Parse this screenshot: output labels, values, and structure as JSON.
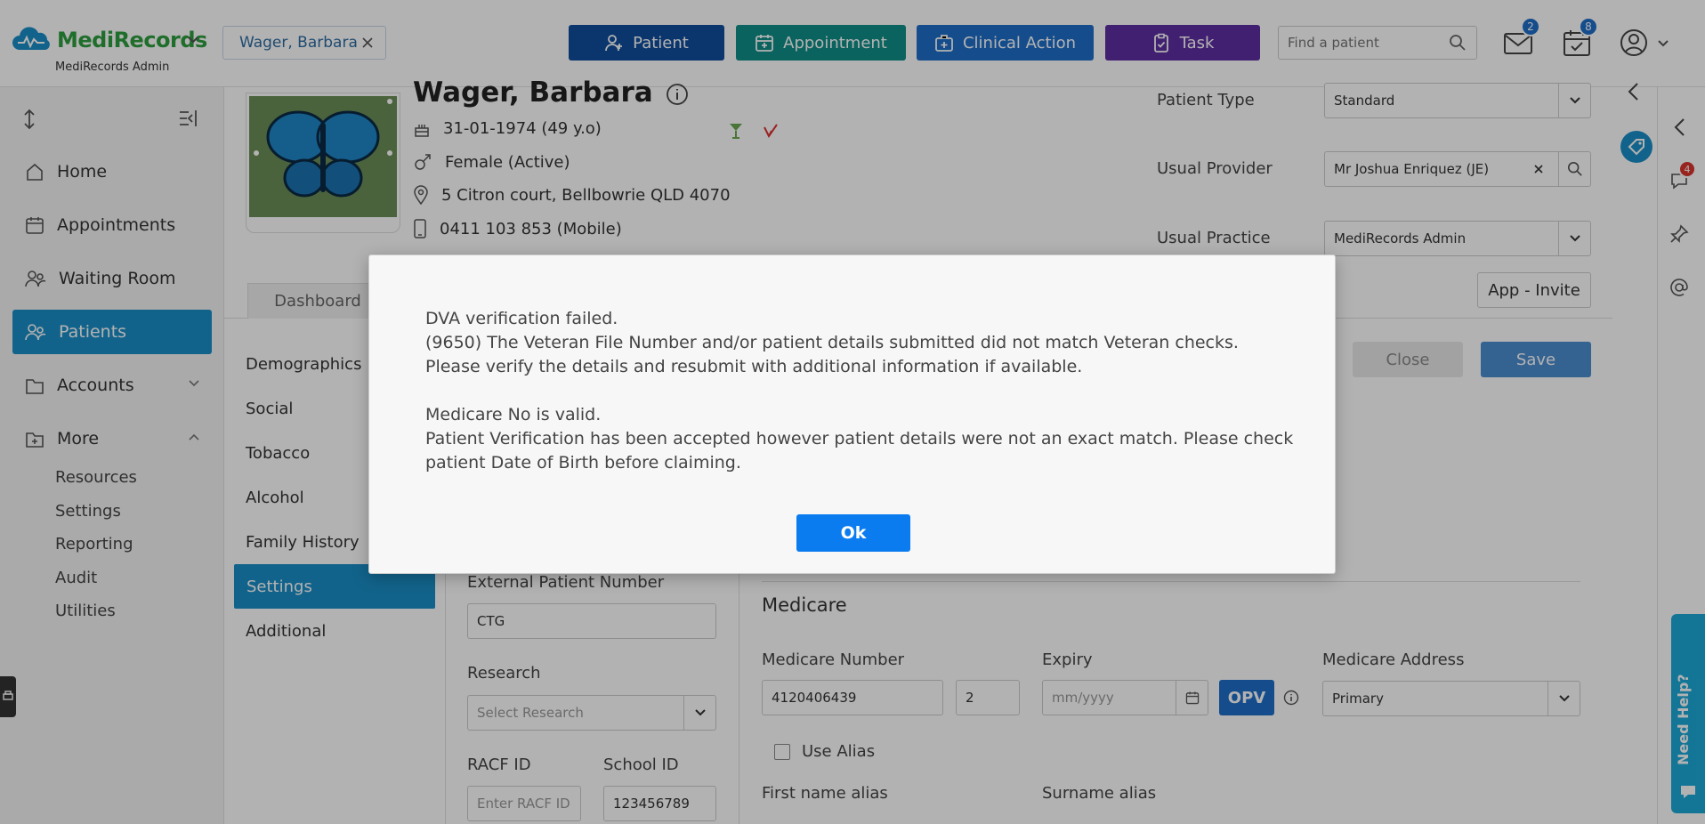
{
  "header": {
    "brand": "MediRecords",
    "brand_sub": "MediRecords Admin",
    "patient_tab": "Wager, Barbara",
    "buttons": {
      "patient": "Patient",
      "appointment": "Appointment",
      "clinical": "Clinical Action",
      "task": "Task"
    },
    "search_placeholder": "Find a patient",
    "mail_count": "2",
    "calendar_count": "8"
  },
  "colors": {
    "patient": "#0f4c9c",
    "appointment": "#0f8f87",
    "clinical": "#1f6fc9",
    "task": "#5f2ea3",
    "accent": "#1b8ec7"
  },
  "sidebar": {
    "items": [
      {
        "label": "Home",
        "icon": "home-icon"
      },
      {
        "label": "Appointments",
        "icon": "calendar-icon"
      },
      {
        "label": "Waiting Room",
        "icon": "people-icon"
      },
      {
        "label": "Patients",
        "icon": "patients-icon"
      },
      {
        "label": "Accounts",
        "icon": "folder-icon"
      },
      {
        "label": "More",
        "icon": "folder-plus-icon"
      }
    ],
    "more_items": [
      "Resources",
      "Settings",
      "Reporting",
      "Audit",
      "Utilities"
    ]
  },
  "patient": {
    "name": "Wager, Barbara",
    "dob": "31-01-1974 (49 y.o)",
    "gender": "Female (Active)",
    "address": "5 Citron court, Bellbowrie QLD 4070",
    "phone": "0411 103 853 (Mobile)"
  },
  "fields": {
    "patient_type_label": "Patient Type",
    "patient_type": "Standard",
    "usual_provider_label": "Usual Provider",
    "usual_provider": "Mr Joshua Enriquez (JE)",
    "usual_practice_label": "Usual Practice",
    "usual_practice": "MediRecords Admin",
    "app_invite": "App - Invite"
  },
  "tabs": {
    "dashboard": "Dashboard"
  },
  "actions": {
    "close": "Close",
    "save": "Save"
  },
  "submenu": [
    "Demographics",
    "Social",
    "Tobacco",
    "Alcohol",
    "Family History",
    "Settings",
    "Additional"
  ],
  "settings_form": {
    "external_label": "External Patient Number",
    "external_value": "CTG",
    "research_label": "Research",
    "research_placeholder": "Select Research",
    "racf_label": "RACF ID",
    "racf_placeholder": "Enter RACF ID",
    "school_label": "School ID",
    "school_value": "123456789"
  },
  "medicare": {
    "title": "Medicare",
    "number_label": "Medicare Number",
    "number": "4120406439",
    "irn": "2",
    "expiry_label": "Expiry",
    "expiry_placeholder": "mm/yyyy",
    "opv": "OPV",
    "address_label": "Medicare Address",
    "address": "Primary",
    "use_alias": "Use Alias",
    "first_alias": "First name alias",
    "surname_alias": "Surname alias"
  },
  "rail": {
    "chat_count": "4",
    "help": "Need Help?"
  },
  "modal": {
    "line1": "DVA verification failed.",
    "line2": "(9650) The Veteran File Number and/or patient details submitted did not match Veteran checks. Please verify the details and resubmit with additional information if available.",
    "line3": "Medicare No is valid.",
    "line4": "Patient Verification has been accepted however patient details were not an exact match. Please check patient Date of Birth before claiming.",
    "ok": "Ok"
  }
}
